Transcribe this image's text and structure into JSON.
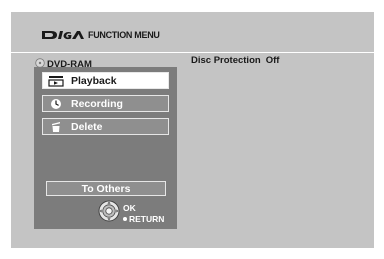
{
  "header": {
    "brand_icon": "diga-logo",
    "title": "FUNCTION MENU"
  },
  "media": {
    "icon": "disc-icon",
    "label": "DVD-RAM"
  },
  "status": {
    "label": "Disc Protection",
    "value": "Off"
  },
  "menu": {
    "items": [
      {
        "label": "Playback",
        "icon": "playback-icon",
        "selected": true
      },
      {
        "label": "Recording",
        "icon": "clock-icon",
        "selected": false
      },
      {
        "label": "Delete",
        "icon": "trash-icon",
        "selected": false
      }
    ],
    "others_label": "To Others"
  },
  "controls": {
    "icon": "cursor-pad-icon",
    "ok_label": "OK",
    "return_label": "RETURN"
  },
  "colors": {
    "screen_bg": "#c4c4c4",
    "panel_bg": "#7c7c7c",
    "item_bg": "#8f8f8f",
    "selected_bg": "#ffffff"
  }
}
